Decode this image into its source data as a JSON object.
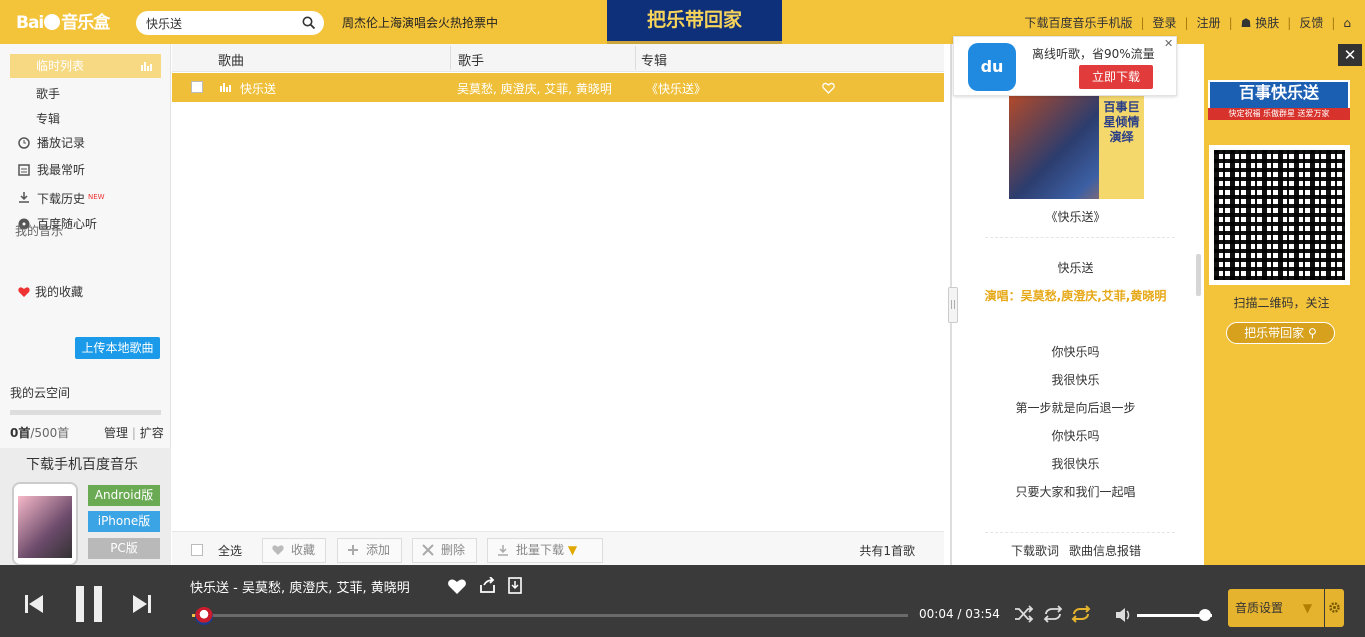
{
  "header": {
    "logo_text": "Bai",
    "logo_suffix": "音乐盒",
    "search_value": "快乐送",
    "marquee": "周杰伦上海演唱会火热抢票中",
    "banner_text": "把乐带回家",
    "links": [
      "下载百度音乐手机版",
      "登录",
      "注册",
      "换肤",
      "反馈"
    ]
  },
  "sidebar": {
    "playlist_label": "临时列表",
    "sub_items": [
      "歌手",
      "专辑"
    ],
    "items": [
      "播放记录",
      "我最常听",
      "下载历史",
      "百度随心听"
    ],
    "new_tag": "NEW",
    "my_music": "我的音乐",
    "favorites": "我的收藏",
    "cloud_label": "我的云空间",
    "upload_label": "上传本地歌曲",
    "quota_used": "0首",
    "quota_total": "/500首",
    "manage": "管理",
    "expand": "扩容",
    "promo_title": "下载手机百度音乐",
    "promo_buttons": [
      "Android版",
      "iPhone版",
      "PC版"
    ]
  },
  "table": {
    "headers": [
      "歌曲",
      "歌手",
      "专辑"
    ],
    "rows": [
      {
        "song": "快乐送",
        "artist": "吴莫愁, 庾澄庆, 艾菲, 黄晓明",
        "album": "《快乐送》"
      }
    ],
    "footer": {
      "select_all": "全选",
      "fav": "收藏",
      "add": "添加",
      "delete": "删除",
      "batch_download": "批量下载",
      "total": "共有1首歌"
    }
  },
  "lyrics_panel": {
    "popup_text": "离线听歌，省90%流量",
    "popup_button": "立即下载",
    "popup_logo": "du",
    "cover_text": "百事巨星倾情演绎",
    "album_title": "《快乐送》",
    "song_title": "快乐送",
    "performers": "演唱：吴莫愁,庾澄庆,艾菲,黄晓明",
    "lines": [
      "你快乐吗",
      "我很快乐",
      "第一步就是向后退一步",
      "你快乐吗",
      "我很快乐",
      "只要大家和我们一起唱"
    ],
    "links": [
      "下载歌词",
      "歌曲信息报错"
    ]
  },
  "ad": {
    "title": "百事快乐送",
    "subtitle": "快定祝福 乐傲群星 送爱万家",
    "scan_text": "扫描二维码，关注",
    "button": "把乐带回家"
  },
  "player": {
    "now_playing": "快乐送  -  吴莫愁, 庾澄庆, 艾菲, 黄晓明",
    "time_current": "00:04",
    "time_total": "03:54",
    "progress": 0.017,
    "volume": 0.9,
    "quality_label": "音质设置"
  },
  "colors": {
    "accent": "#f3c33a",
    "row_active": "#efbf3a",
    "player_bg": "#3a3a3a"
  }
}
